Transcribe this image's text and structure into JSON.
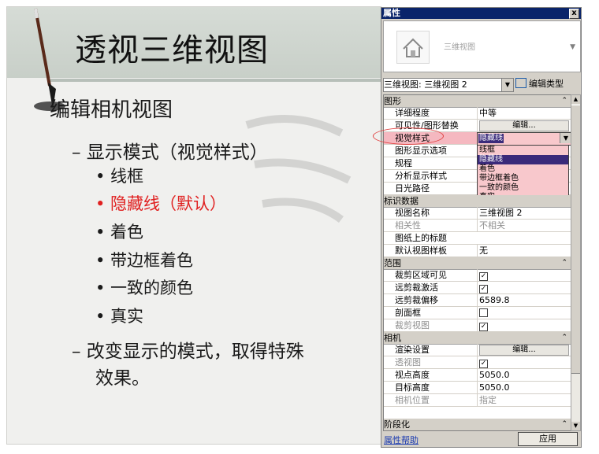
{
  "slide": {
    "title": "透视三维视图",
    "bullets": [
      {
        "level": 1,
        "text": "编辑相机视图"
      },
      {
        "level": 2,
        "text": "– 显示模式（视觉样式）"
      },
      {
        "level": 3,
        "text": "• 线框"
      },
      {
        "level": 3,
        "text": "• 隐藏线（默认）",
        "highlight": true
      },
      {
        "level": 3,
        "text": "• 着色"
      },
      {
        "level": 3,
        "text": "• 带边框着色"
      },
      {
        "level": 3,
        "text": "• 一致的颜色"
      },
      {
        "level": 3,
        "text": "• 真实"
      },
      {
        "level": 2,
        "text": "– 改变显示的模式，取得特殊"
      },
      {
        "level": 2,
        "text": "效果。"
      }
    ]
  },
  "panel": {
    "title": "属性",
    "close": "x",
    "type_name": "三维视图",
    "view_selector": "三维视图: 三维视图 2",
    "edit_type": "编辑类型",
    "sections": {
      "graphics": "图形",
      "identity": "标识数据",
      "extents": "范围",
      "camera": "相机",
      "phasing": "阶段化"
    },
    "graphics_rows": {
      "detail_level": {
        "k": "详细程度",
        "v": "中等"
      },
      "vg_overrides": {
        "k": "可见性/图形替换",
        "v": "编辑..."
      },
      "visual_style": {
        "k": "视觉样式",
        "v": "隐藏线"
      },
      "display_options": {
        "k": "图形显示选项"
      },
      "discipline": {
        "k": "规程"
      },
      "analysis_style": {
        "k": "分析显示样式"
      },
      "sun_path": {
        "k": "日光路径"
      }
    },
    "visual_style_options": [
      "线框",
      "隐藏线",
      "着色",
      "带边框着色",
      "一致的颜色",
      "真实"
    ],
    "identity_rows": {
      "view_name": {
        "k": "视图名称",
        "v": "三维视图 2"
      },
      "dependency": {
        "k": "相关性",
        "v": "不相关"
      },
      "title_on_sheet": {
        "k": "图纸上的标题"
      },
      "default_template": {
        "k": "默认视图样板",
        "v": "无"
      }
    },
    "extents_rows": {
      "crop_visible": {
        "k": "裁剪区域可见"
      },
      "far_clip_active": {
        "k": "远剪裁激活"
      },
      "far_clip_offset": {
        "k": "远剪裁偏移",
        "v": "6589.8"
      },
      "section_box": {
        "k": "剖面框"
      },
      "crop_view": {
        "k": "裁剪视图"
      }
    },
    "camera_rows": {
      "render_settings": {
        "k": "渲染设置",
        "v": "编辑..."
      },
      "perspective": {
        "k": "透视图"
      },
      "eye_elevation": {
        "k": "视点高度",
        "v": "5050.0"
      },
      "target_elevation": {
        "k": "目标高度",
        "v": "5050.0"
      },
      "camera_position": {
        "k": "相机位置",
        "v": "指定"
      }
    },
    "help_link": "属性帮助",
    "apply": "应用",
    "check": "✓"
  }
}
